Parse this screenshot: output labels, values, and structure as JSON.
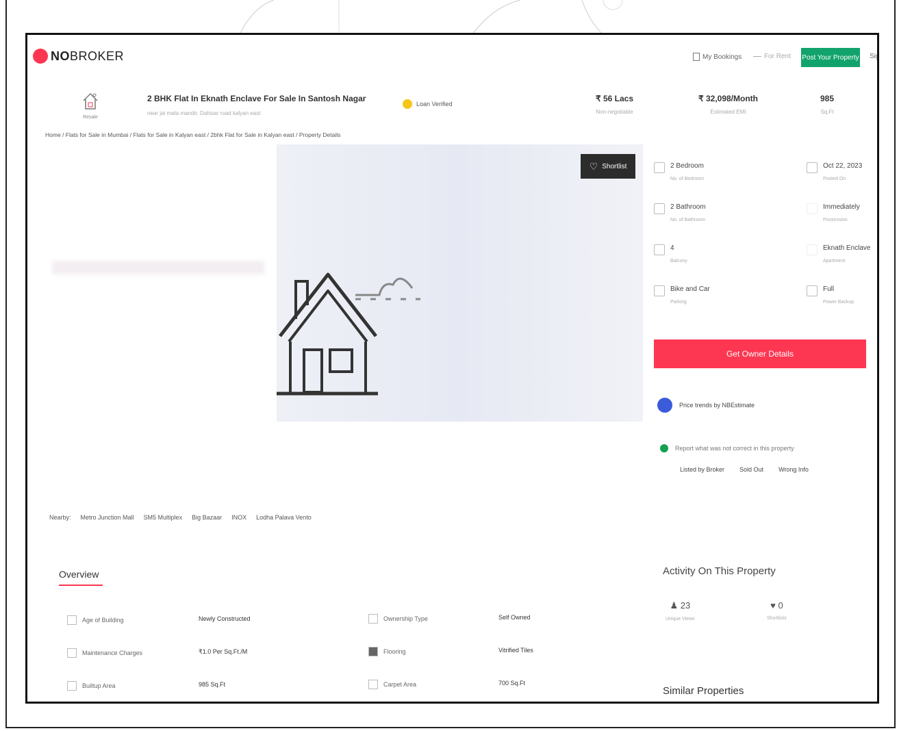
{
  "header": {
    "logo_prefix": "NO",
    "logo_suffix": "BROKER",
    "my_bookings": "My Bookings",
    "for_rent": "For Rent",
    "post_property": "Post Your Property",
    "sign": "Sig"
  },
  "property": {
    "tag": "Resale",
    "title": "2 BHK Flat In Eknath Enclave For Sale In Santosh Nagar",
    "subtitle": "near jai mata mandir, Dahisar road kalyan east",
    "loan": "Loan Verified",
    "price": "₹ 56 Lacs",
    "price_note": "Non-negotiable",
    "emi": "₹ 32,098/Month",
    "emi_note": "Estimated EMI",
    "area": "985",
    "area_unit": "Sq.Ft"
  },
  "breadcrumb": "Home / Flats for Sale in Mumbai / Flats for Sale in Kalyan east / 2bhk Flat for Sale in Kalyan east / Property Details",
  "gallery": {
    "shortlist": "Shortlist"
  },
  "specs": [
    {
      "value": "2 Bedroom",
      "label": "No. of Bedroom"
    },
    {
      "value": "Oct 22, 2023",
      "label": "Posted On"
    },
    {
      "value": "2 Bathroom",
      "label": "No. of Bathroom"
    },
    {
      "value": "Immediately",
      "label": "Possession"
    },
    {
      "value": "4",
      "label": "Balcony"
    },
    {
      "value": "Eknath Enclave",
      "label": "Apartment"
    },
    {
      "value": "Bike and Car",
      "label": "Parking"
    },
    {
      "value": "Full",
      "label": "Power Backup"
    }
  ],
  "owner_button": "Get Owner Details",
  "price_trends": "Price trends by NBEstimate",
  "report": {
    "text": "Report what was not correct in this property",
    "options": [
      "Listed by Broker",
      "Sold Out",
      "Wrong Info"
    ]
  },
  "nearby": [
    "Nearby:",
    "Metro Junction Mall",
    "SM5 Multiplex",
    "Big Bazaar",
    "INOX",
    "Lodha Palava Vento"
  ],
  "overview": {
    "title": "Overview",
    "rows": [
      {
        "label": "Age of Building",
        "value": "Newly Constructed"
      },
      {
        "label": "Ownership Type",
        "value": "Self Owned"
      },
      {
        "label": "Maintenance Charges",
        "value": "₹1.0 Per Sq.Ft./M"
      },
      {
        "label": "Flooring",
        "value": "Vitrified Tiles"
      },
      {
        "label": "Builtup Area",
        "value": "985 Sq.Ft"
      },
      {
        "label": "Carpet Area",
        "value": "700 Sq.Ft"
      }
    ]
  },
  "activity": {
    "title": "Activity On This Property",
    "views": "23",
    "views_label": "Unique Views",
    "shortlists": "0",
    "shortlists_label": "Shortlists"
  },
  "similar": "Similar Properties",
  "colors": {
    "brand": "#fd3752",
    "post_button": "#11a36b",
    "price_trends_icon": "#3b5bdb",
    "report_dot": "#12a150"
  }
}
